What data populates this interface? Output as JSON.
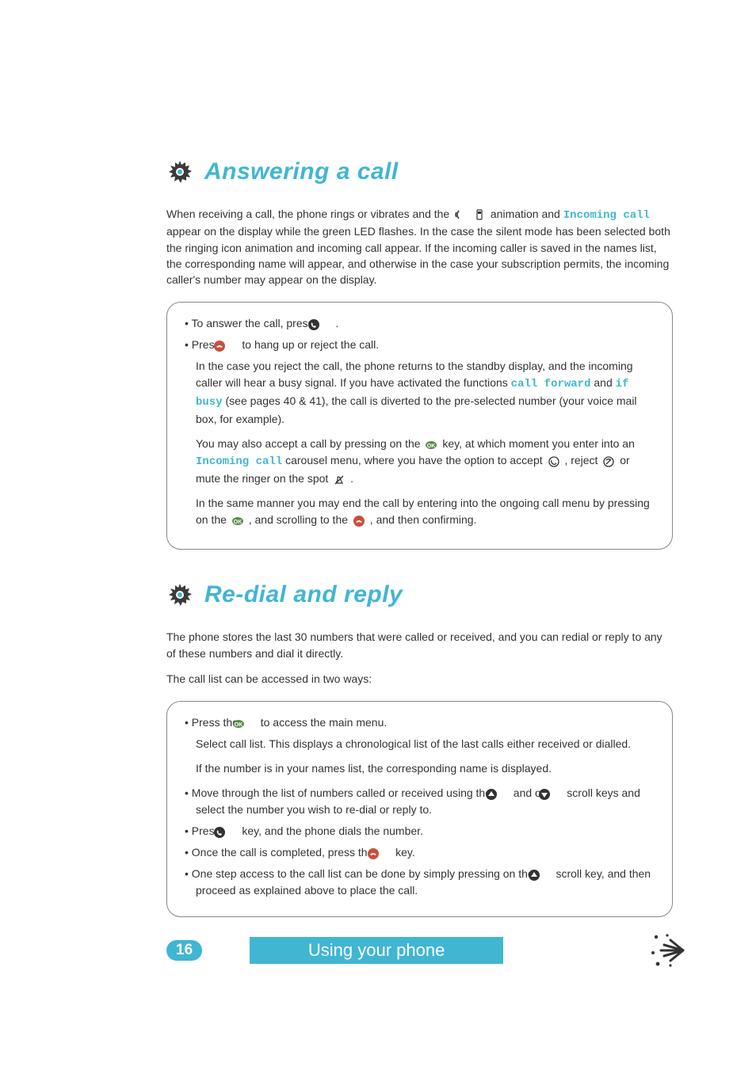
{
  "section1": {
    "title": "Answering a call",
    "intro_part1": "When receiving a call, the phone rings or vibrates and the ",
    "intro_part2": " animation and ",
    "intro_code": "Incoming call",
    "intro_part3": " appear on the display while the green LED flashes. In the case the silent mode has been selected both the ringing icon animation and incoming call appear. If the incoming caller is saved in the names list, the corresponding name will appear, and otherwise in the case your subscription permits, the incoming caller's number may appear on the display.",
    "box": {
      "item1_a": "To answer the call, press ",
      "item1_b": " .",
      "item2_a": "Press ",
      "item2_b": " to hang up or reject the call.",
      "para1_a": "In the case you reject the call, the phone returns to the standby display, and the incoming caller will hear a busy signal.  If you have activated the functions ",
      "para1_code1": "call forward",
      "para1_b": " and ",
      "para1_code2": "if busy",
      "para1_c": " (see pages 40 & 41), the call is diverted to the pre-selected number (your voice mail box, for example).",
      "para2_a": "You may also accept a call by pressing on the ",
      "para2_b": " key, at which moment you enter into an ",
      "para2_code": "Incoming call",
      "para2_c": " carousel menu, where you have the option to accept ",
      "para2_d": ", reject ",
      "para2_e": " or mute the ringer on the spot ",
      "para2_f": " .",
      "para3_a": "In the same manner you may end the call by entering into the ongoing call menu by pressing on the ",
      "para3_b": " , and scrolling to the ",
      "para3_c": " , and then confirming."
    }
  },
  "section2": {
    "title": "Re-dial and reply",
    "intro1": "The phone stores the last 30 numbers that were called or received, and you can redial or reply to any of these numbers and dial it directly.",
    "intro2": "The call list can be accessed in two ways:",
    "box": {
      "item1_a": "Press the ",
      "item1_b": " to access the main menu.",
      "item1_sub1": "Select call list.  This displays a chronological list of the last calls either received or dialled.",
      "item1_sub2": "If the number is in your names list, the corresponding name is displayed.",
      "item2_a": "Move through the list of numbers called or received using the ",
      "item2_b": " and or ",
      "item2_c": " scroll keys and select the number you wish to re-dial or reply to.",
      "item3_a": "Press ",
      "item3_b": " key, and the phone dials the number.",
      "item4_a": "Once the call is completed, press the ",
      "item4_b": " key.",
      "item5_a": "One step access to the call list can be done by simply pressing on the ",
      "item5_b": " scroll key, and then proceed as explained above to place the call."
    }
  },
  "footer": {
    "page_number": "16",
    "section_title": "Using your phone"
  },
  "icons": {
    "gear": "gear-icon",
    "ringing": "ringing-icon",
    "phone": "phone-icon",
    "call_green": "call-key-icon",
    "end_red": "end-key-icon",
    "ok": "ok-key-icon",
    "accept": "accept-icon",
    "reject": "reject-icon",
    "mute": "mute-icon",
    "scroll_up": "scroll-up-icon",
    "scroll_down": "scroll-down-icon"
  }
}
